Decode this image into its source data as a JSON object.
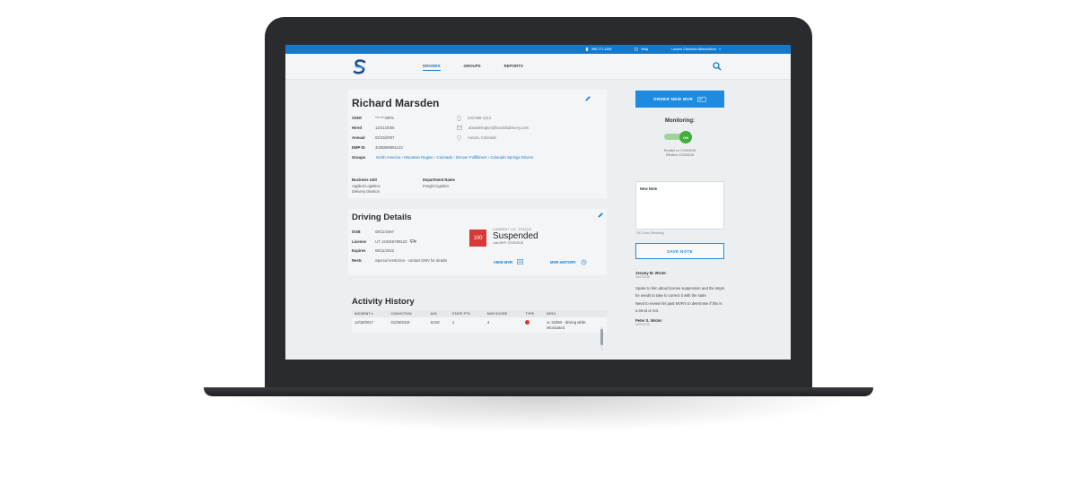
{
  "topbar": {
    "phone": "555-777-1000",
    "help": "Help",
    "user": "Lauren Christine-Manwelleen"
  },
  "nav": {
    "items": [
      {
        "label": "DRIVERS",
        "active": true
      },
      {
        "label": "GROUPS",
        "active": false
      },
      {
        "label": "REPORTS",
        "active": false
      }
    ]
  },
  "driver": {
    "name": "Richard Marsden",
    "fields": [
      {
        "key": "SSN#",
        "value": "***-**-8975"
      },
      {
        "key": "Hired",
        "value": "12/21/2006"
      },
      {
        "key": "Annual",
        "value": "02/15/2007"
      },
      {
        "key": "EMP ID",
        "value": "3338889991123"
      }
    ],
    "groups_label": "Groups",
    "groups": [
      "North America",
      "Mountain Region",
      "Colorado",
      "Denver Fulfillment",
      "Colorado Springs Drivers"
    ],
    "contact": {
      "phone": "333-555-1212",
      "email": "abwashington@haroldsdelivery.com",
      "location": "Aurora, Colorado"
    },
    "business_unit_label": "Business Unit",
    "business_unit_lines": [
      "Applied Logistics",
      "Delivery Division"
    ],
    "department_label": "Department Name",
    "department_value": "Freight logistics"
  },
  "driving": {
    "title": "Driving Details",
    "fields": [
      {
        "key": "DOB",
        "value": "08/11/1967"
      },
      {
        "key": "License",
        "value": "UT 123456789123"
      },
      {
        "key": "Expires",
        "value": "08/11/2022"
      },
      {
        "key": "Restr.",
        "value": "Special restriction - contact DMV for details"
      }
    ],
    "score": "100",
    "status_label": "CURRENT LIC. STATUS",
    "status": "Suspended",
    "last_mvr": "Last MVR: 07/09/2018",
    "view_mvr": "VIEW MVR",
    "mvr_history": "MVR HISTORY"
  },
  "activity": {
    "title": "Activity History",
    "columns": [
      "INCIDENT",
      "CONVICTION",
      "AVD",
      "STATE PTS",
      "MVR SCORE",
      "TYPE",
      "DESC."
    ],
    "rows": [
      {
        "incident": "12/19/2017",
        "conviction": "01/25/2018",
        "avd": "SA02",
        "state_pts": "1",
        "mvr_score": "4",
        "desc": "vc 22350 - driving while intoxicated"
      }
    ]
  },
  "sidebar": {
    "order_button": "ORDER NEW MVR",
    "monitoring_label": "Monitoring:",
    "toggle_label": "ON",
    "enrolled": "Enrolled on: 07/09/2018",
    "effective": "Effective: 07/09/2018",
    "note_label": "New Note",
    "note_remaining": "200 Chars Remaining",
    "save_button": "SAVE NOTE",
    "notes": [
      {
        "author": "Jeramy M. Wrote:",
        "date": "06/09/2018",
        "paragraphs": [
          "Spoke to him about license suspension and the steps he needs to take to correct it with the state.",
          "Need to review his past MVR's to determine if this is a trend or not."
        ]
      },
      {
        "author": "Peter S. Wrote:",
        "date": "06/09/2018",
        "paragraphs": []
      }
    ]
  },
  "colors": {
    "accent": "#1679c8",
    "danger": "#d73838",
    "success": "#3fae3a"
  }
}
